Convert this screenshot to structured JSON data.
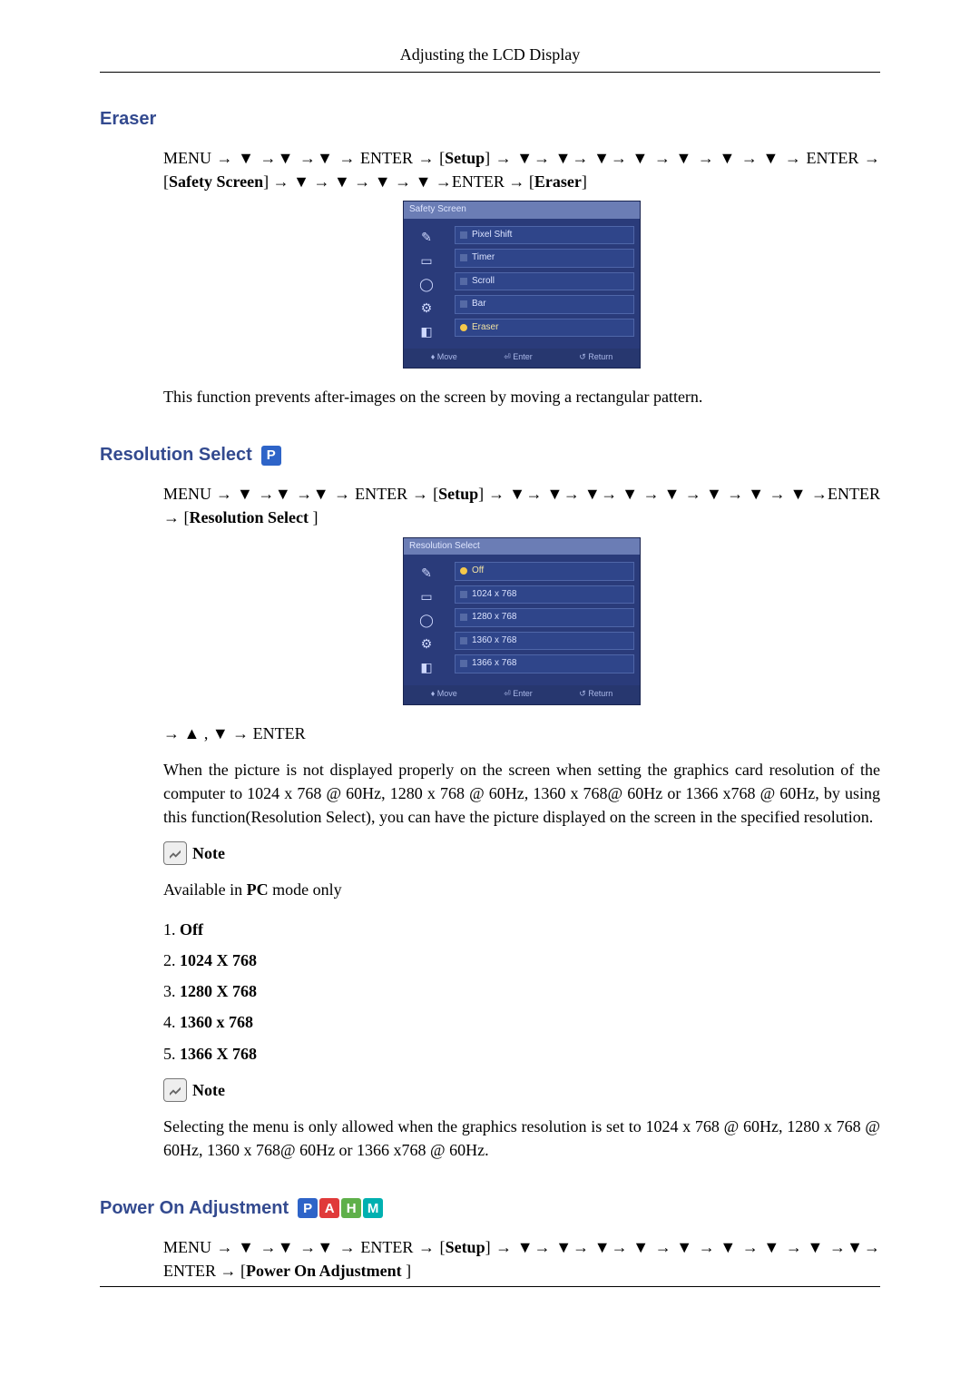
{
  "header": "Adjusting the LCD Display",
  "sections": {
    "eraser": {
      "heading": "Eraser",
      "nav": "MENU → ▼ →▼ →▼ → ENTER → [Setup] → ▼→ ▼→ ▼→ ▼ → ▼ → ▼ → ▼ → ENTER → [Safety Screen] → ▼ → ▼ → ▼ → ▼ →ENTER → [Eraser]",
      "osd": {
        "title": "Safety Screen",
        "items": [
          "Pixel Shift",
          "Timer",
          "Scroll",
          "Bar",
          "Eraser"
        ],
        "selected_index": 4,
        "footer": {
          "move": "Move",
          "enter": "Enter",
          "return": "Return"
        }
      },
      "body": "This function prevents after-images on the screen by moving a rectangular pattern."
    },
    "resolution": {
      "heading": "Resolution Select",
      "nav": "MENU → ▼ →▼ →▼ → ENTER → [Setup] → ▼→ ▼→ ▼→ ▼ → ▼ → ▼ → ▼ → ▼ →ENTER → [Resolution Select ]",
      "osd": {
        "title": "Resolution Select",
        "items": [
          "Off",
          "1024 x 768",
          "1280 x 768",
          "1360 x 768",
          "1366 x 768"
        ],
        "selected_index": 0,
        "footer": {
          "move": "Move",
          "enter": "Enter",
          "return": "Return"
        }
      },
      "post_nav": "→ ▲ , ▼ → ENTER",
      "body": "When the picture is not displayed properly on the screen when setting the graphics card resolution of the computer to 1024 x 768 @ 60Hz, 1280 x 768 @ 60Hz, 1360 x 768@ 60Hz or 1366 x768 @ 60Hz, by using this function(Resolution Select), you can have the picture displayed on the screen in the specified resolution.",
      "note_label": "Note",
      "note_body": "Available in PC mode only",
      "list": [
        "Off",
        "1024 X 768",
        "1280 X 768",
        "1360 x 768",
        "1366 X 768"
      ],
      "note2_label": "Note",
      "note2_body": "Selecting the menu is only allowed when the graphics resolution is set to 1024 x 768 @ 60Hz, 1280 x 768 @ 60Hz, 1360 x 768@ 60Hz or 1366 x768 @ 60Hz."
    },
    "power": {
      "heading": "Power On Adjustment",
      "badges": [
        "P",
        "A",
        "H",
        "M"
      ],
      "nav": "MENU → ▼ →▼ →▼ → ENTER → [Setup] → ▼→ ▼→ ▼→ ▼ → ▼ → ▼ → ▼ → ▼ →▼→ ENTER → [Power On Adjustment ]"
    }
  },
  "pc_mode_bold": "PC"
}
